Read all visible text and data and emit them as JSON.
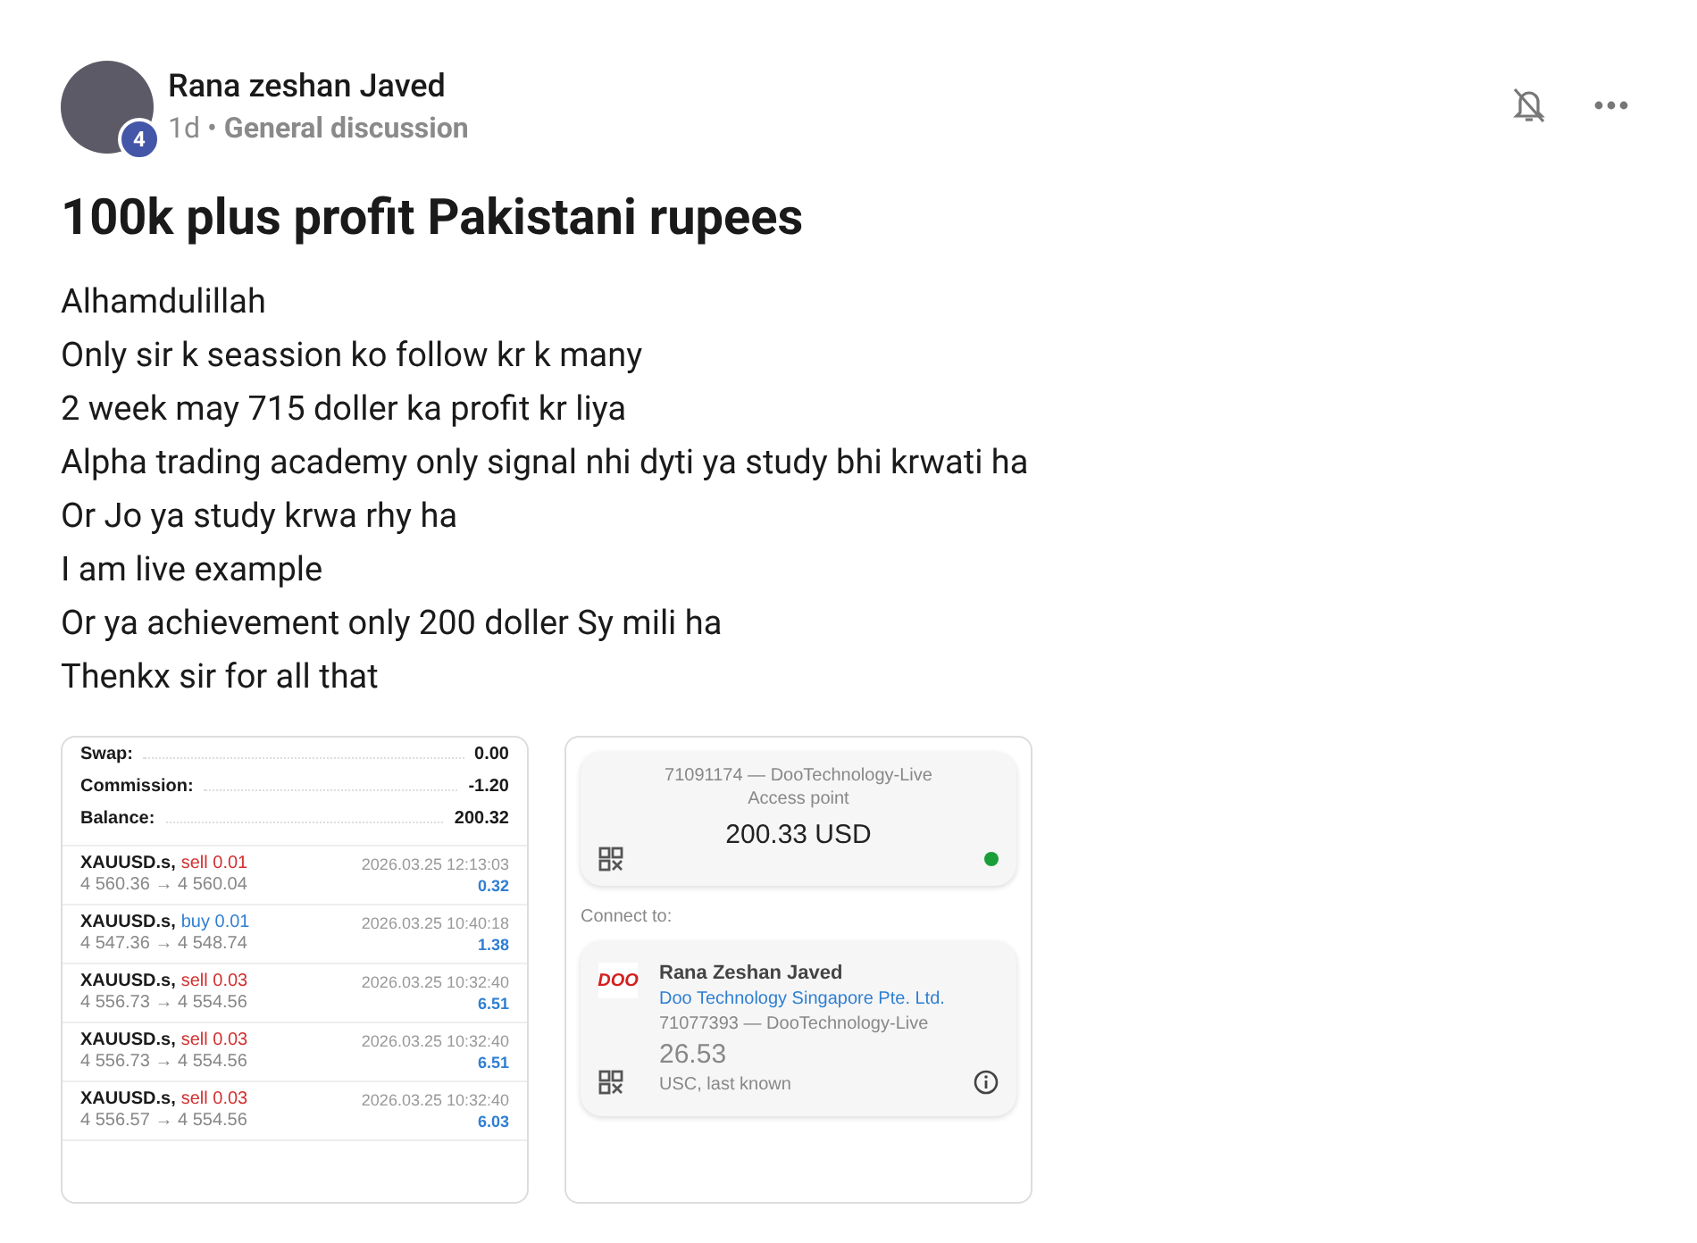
{
  "post": {
    "author": "Rana zeshan Javed",
    "badge": "4",
    "age": "1d",
    "separator": "•",
    "category": "General discussion",
    "notifications_muted": true,
    "title": "100k plus profit Pakistani rupees",
    "body": [
      "Alhamdulillah",
      "Only sir k seassion ko follow kr k many",
      "2 week may 715 doller ka profit kr liya",
      "Alpha trading academy only signal nhi dyti ya study bhi krwati ha",
      "Or Jo ya study krwa rhy ha",
      "I am live example",
      "Or ya achievement only 200 doller Sy mili ha",
      "Thenkx sir for all that"
    ]
  },
  "history_image": {
    "summary": [
      {
        "label": "Swap:",
        "value": "0.00"
      },
      {
        "label": "Commission:",
        "value": "-1.20"
      },
      {
        "label": "Balance:",
        "value": "200.32"
      }
    ],
    "trades": [
      {
        "symbol": "XAUUSD.s,",
        "kind": "sell",
        "order": "sell 0.01",
        "prices": "4 560.36 → 4 560.04",
        "time": "2026.03.25 12:13:03",
        "profit": "0.32"
      },
      {
        "symbol": "XAUUSD.s,",
        "kind": "buy",
        "order": "buy 0.01",
        "prices": "4 547.36 → 4 548.74",
        "time": "2026.03.25 10:40:18",
        "profit": "1.38"
      },
      {
        "symbol": "XAUUSD.s,",
        "kind": "sell",
        "order": "sell 0.03",
        "prices": "4 556.73 → 4 554.56",
        "time": "2026.03.25 10:32:40",
        "profit": "6.51"
      },
      {
        "symbol": "XAUUSD.s,",
        "kind": "sell",
        "order": "sell 0.03",
        "prices": "4 556.73 → 4 554.56",
        "time": "2026.03.25 10:32:40",
        "profit": "6.51"
      },
      {
        "symbol": "XAUUSD.s,",
        "kind": "sell",
        "order": "sell 0.03",
        "prices": "4 556.57 → 4 554.56",
        "time": "2026.03.25 10:32:40",
        "profit": "6.03"
      }
    ]
  },
  "accounts_image": {
    "current": {
      "account": "71091174 — DooTechnology-Live",
      "access": "Access point",
      "balance": "200.33 USD",
      "connected": true
    },
    "connect_label": "Connect to:",
    "other": {
      "name": "Rana Zeshan Javed",
      "broker": "Doo Technology Singapore Pte. Ltd.",
      "logo": "DOO",
      "account": "71077393 — DooTechnology-Live",
      "balance": "26.53",
      "note": "USC, last known"
    }
  }
}
